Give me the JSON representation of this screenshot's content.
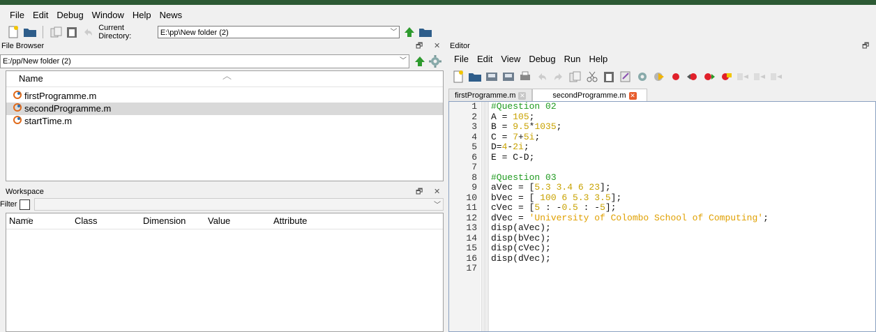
{
  "menubar": [
    "File",
    "Edit",
    "Debug",
    "Window",
    "Help",
    "News"
  ],
  "toolbar": {
    "current_directory_label": "Current Directory:",
    "current_directory_value": "E:\\pp\\New folder (2)"
  },
  "file_browser": {
    "title": "File Browser",
    "path": "E:/pp/New folder (2)",
    "column_name": "Name",
    "files": [
      "firstProgramme.m",
      "secondProgramme.m",
      "startTime.m"
    ],
    "selected_index": 1
  },
  "workspace": {
    "title": "Workspace",
    "filter_label": "Filter",
    "columns": [
      "Name",
      "Class",
      "Dimension",
      "Value",
      "Attribute"
    ]
  },
  "editor": {
    "title": "Editor",
    "menu": [
      "File",
      "Edit",
      "View",
      "Debug",
      "Run",
      "Help"
    ],
    "tabs": [
      {
        "label": "firstProgramme.m",
        "active": false
      },
      {
        "label": "secondProgramme.m",
        "active": true
      }
    ],
    "lines": [
      [
        {
          "t": "#Question 02",
          "c": "comment"
        }
      ],
      [
        {
          "t": "A = ",
          "c": "plain"
        },
        {
          "t": "105",
          "c": "num"
        },
        {
          "t": ";",
          "c": "plain"
        }
      ],
      [
        {
          "t": "B = ",
          "c": "plain"
        },
        {
          "t": "9.5",
          "c": "num"
        },
        {
          "t": "*",
          "c": "plain"
        },
        {
          "t": "1035",
          "c": "num"
        },
        {
          "t": ";",
          "c": "plain"
        }
      ],
      [
        {
          "t": "C = ",
          "c": "plain"
        },
        {
          "t": "7",
          "c": "num"
        },
        {
          "t": "+",
          "c": "plain"
        },
        {
          "t": "5i",
          "c": "num"
        },
        {
          "t": ";",
          "c": "plain"
        }
      ],
      [
        {
          "t": "D=",
          "c": "plain"
        },
        {
          "t": "4",
          "c": "num"
        },
        {
          "t": "-",
          "c": "plain"
        },
        {
          "t": "2i",
          "c": "num"
        },
        {
          "t": ";",
          "c": "plain"
        }
      ],
      [
        {
          "t": "E = C-D;",
          "c": "plain"
        }
      ],
      [],
      [
        {
          "t": "#Question 03",
          "c": "comment"
        }
      ],
      [
        {
          "t": "aVec = [",
          "c": "plain"
        },
        {
          "t": "5.3 3.4 6 23",
          "c": "num"
        },
        {
          "t": "];",
          "c": "plain"
        }
      ],
      [
        {
          "t": "bVec = [ ",
          "c": "plain"
        },
        {
          "t": "100 6 5.3 3.5",
          "c": "num"
        },
        {
          "t": "];",
          "c": "plain"
        }
      ],
      [
        {
          "t": "cVec = [",
          "c": "plain"
        },
        {
          "t": "5",
          "c": "num"
        },
        {
          "t": " : -",
          "c": "plain"
        },
        {
          "t": "0.5",
          "c": "num"
        },
        {
          "t": " : -",
          "c": "plain"
        },
        {
          "t": "5",
          "c": "num"
        },
        {
          "t": "];",
          "c": "plain"
        }
      ],
      [
        {
          "t": "dVec = ",
          "c": "plain"
        },
        {
          "t": "'University of Colombo School of Computing'",
          "c": "str"
        },
        {
          "t": ";",
          "c": "plain"
        }
      ],
      [
        {
          "t": "disp(aVec);",
          "c": "plain"
        }
      ],
      [
        {
          "t": "disp(bVec);",
          "c": "plain"
        }
      ],
      [
        {
          "t": "disp(cVec);",
          "c": "plain"
        }
      ],
      [
        {
          "t": "disp(dVec);",
          "c": "plain"
        }
      ],
      []
    ]
  }
}
